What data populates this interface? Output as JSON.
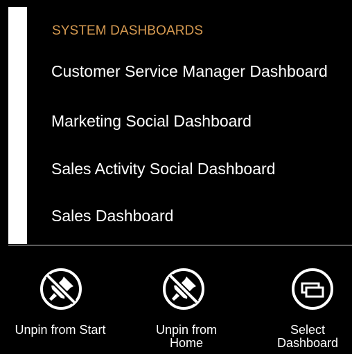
{
  "section": {
    "header": "SYSTEM DASHBOARDS"
  },
  "dashboards": [
    {
      "label": "Customer Service Manager Dashboard"
    },
    {
      "label": "Marketing Social Dashboard"
    },
    {
      "label": "Sales Activity Social Dashboard"
    },
    {
      "label": "Sales Dashboard"
    }
  ],
  "appbar": {
    "unpin_start": {
      "label": "Unpin from Start",
      "icon": "unpin-icon"
    },
    "unpin_home": {
      "label_line1": "Unpin from",
      "label_line2": "Home",
      "icon": "unpin-icon"
    },
    "select_dashboard": {
      "label_line1": "Select",
      "label_line2": "Dashboard",
      "icon": "select-dashboard-icon"
    }
  },
  "colors": {
    "background": "#000000",
    "header_accent": "#d69a51",
    "text": "#ffffff"
  }
}
